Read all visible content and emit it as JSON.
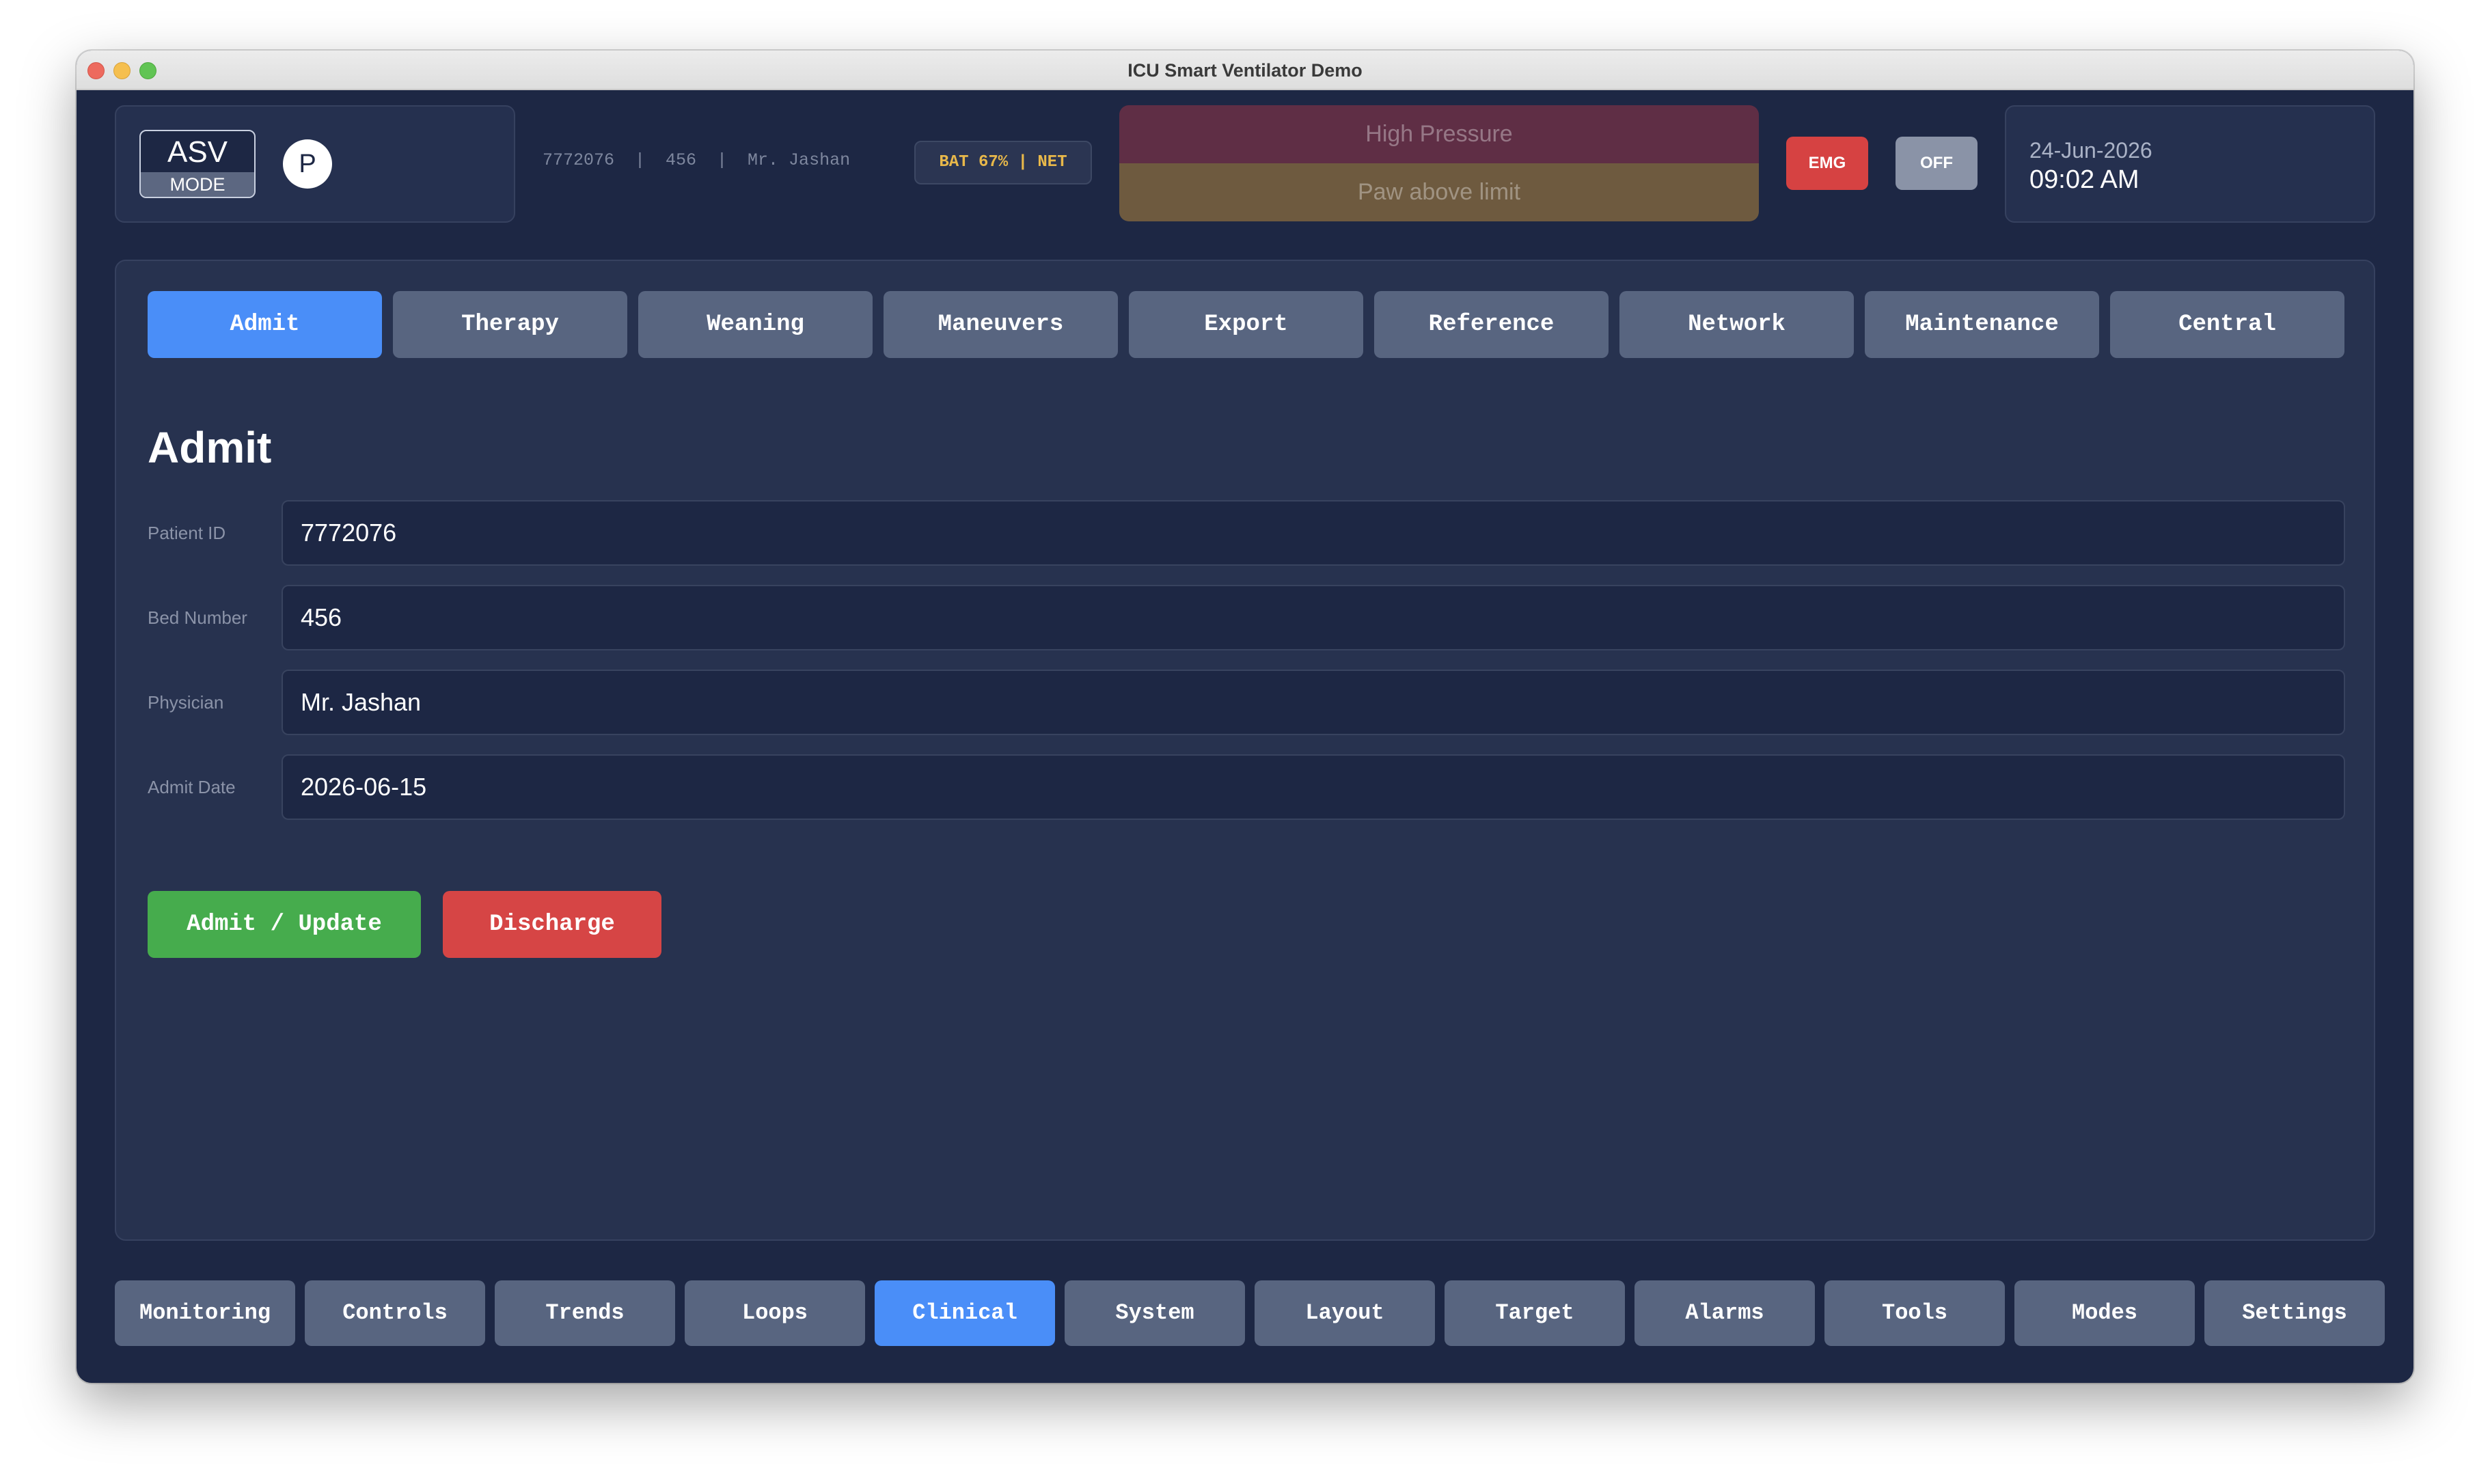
{
  "window": {
    "title": "ICU Smart Ventilator Demo"
  },
  "header": {
    "mode": {
      "name": "ASV",
      "label": "MODE",
      "indicator": "P"
    },
    "patient_line": "7772076  |  456  |  Mr. Jashan",
    "battery_network": "BAT 67% | NET",
    "alarms": [
      {
        "text": "High Pressure",
        "color": "#5f2e45"
      },
      {
        "text": "Paw above limit",
        "color": "#6e5a3f"
      }
    ],
    "emg_label": "EMG",
    "off_label": "OFF",
    "date": "24-Jun-2026",
    "time": "09:02 AM"
  },
  "tabs": [
    {
      "label": "Admit",
      "active": true
    },
    {
      "label": "Therapy"
    },
    {
      "label": "Weaning"
    },
    {
      "label": "Maneuvers"
    },
    {
      "label": "Export"
    },
    {
      "label": "Reference"
    },
    {
      "label": "Network"
    },
    {
      "label": "Maintenance"
    },
    {
      "label": "Central"
    }
  ],
  "admit": {
    "title": "Admit",
    "fields": [
      {
        "label": "Patient ID",
        "value": "7772076"
      },
      {
        "label": "Bed Number",
        "value": "456"
      },
      {
        "label": "Physician",
        "value": "Mr. Jashan"
      },
      {
        "label": "Admit Date",
        "value": "2026-06-15"
      }
    ],
    "admit_button": "Admit / Update",
    "discharge_button": "Discharge"
  },
  "bottom_nav": [
    {
      "label": "Monitoring"
    },
    {
      "label": "Controls"
    },
    {
      "label": "Trends"
    },
    {
      "label": "Loops"
    },
    {
      "label": "Clinical",
      "active": true
    },
    {
      "label": "System"
    },
    {
      "label": "Layout"
    },
    {
      "label": "Target"
    },
    {
      "label": "Alarms"
    },
    {
      "label": "Tools"
    },
    {
      "label": "Modes"
    },
    {
      "label": "Settings"
    }
  ],
  "colors": {
    "accent": "#4a8ef8",
    "background": "#1d2744",
    "panel": "#27324f",
    "admit_green": "#46ac4d",
    "discharge_red": "#d64545"
  }
}
